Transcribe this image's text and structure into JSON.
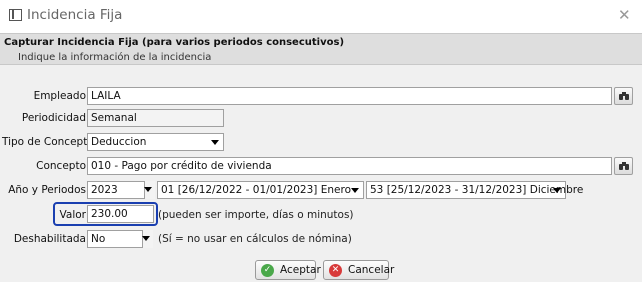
{
  "window": {
    "title": "Incidencia Fija",
    "close_glyph": "✕"
  },
  "header": {
    "title": "Capturar Incidencia Fija (para varios periodos consecutivos)",
    "subtitle": "Indique la información de la incidencia"
  },
  "form": {
    "empleado": {
      "label": "Empleado",
      "value": "LAILA"
    },
    "periodicidad": {
      "label": "Periodicidad",
      "value": "Semanal"
    },
    "tipo_concepto": {
      "label": "Tipo de Concepto",
      "value": "Deduccion"
    },
    "concepto": {
      "label": "Concepto",
      "value": "010 - Pago por crédito de vivienda"
    },
    "anio_periodos": {
      "label": "Año y Periodos",
      "year": "2023",
      "period_from": "01 [26/12/2022 - 01/01/2023] Enero",
      "period_to": "53 [25/12/2023 - 31/12/2023] Diciembre"
    },
    "valor": {
      "label": "Valor",
      "value": "230.00",
      "hint": "(pueden ser importe, días o minutos)"
    },
    "deshabilitada": {
      "label": "Deshabilitada",
      "value": "No",
      "hint": "(Sí = no usar en cálculos de nómina)"
    }
  },
  "buttons": {
    "accept": "Aceptar",
    "cancel": "Cancelar"
  },
  "icons": {
    "window": "window-icon",
    "search": "binoculars-icon",
    "accept": "check-circle-icon",
    "cancel": "x-circle-icon"
  },
  "colors": {
    "highlight": "#1a3fb0",
    "accept": "#4aa84a",
    "cancel": "#d83a3a"
  }
}
